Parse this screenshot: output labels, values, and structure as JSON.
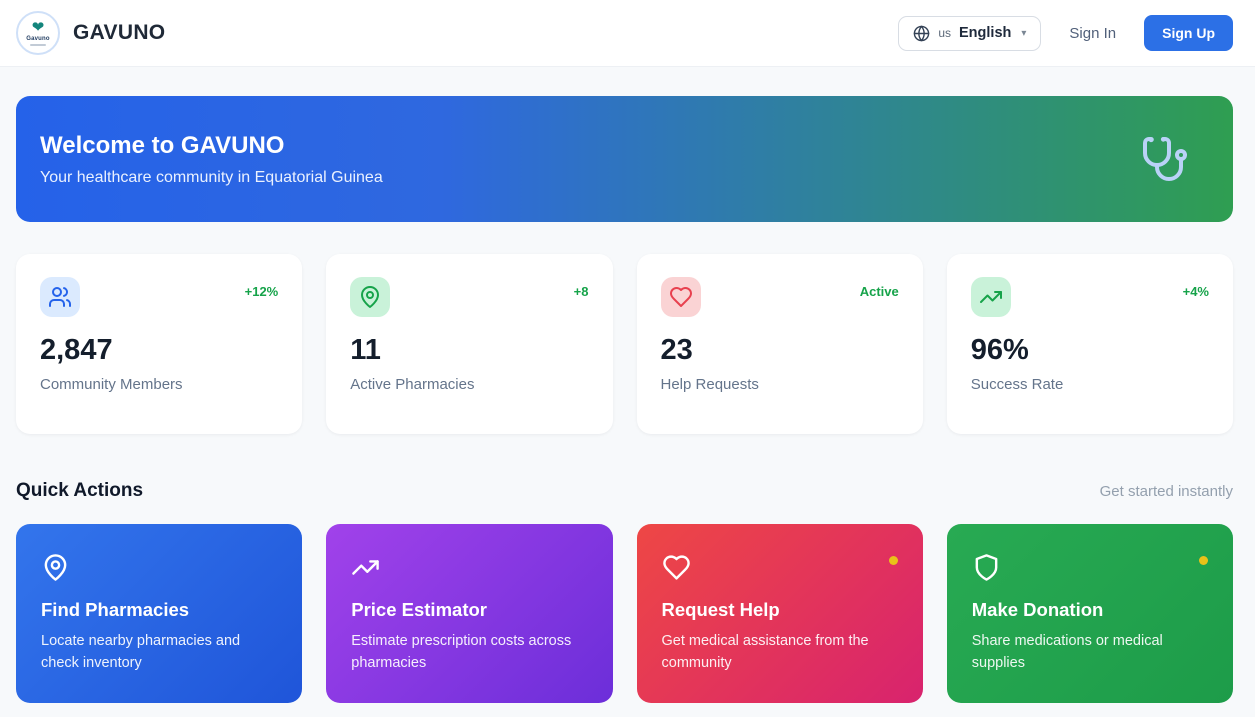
{
  "header": {
    "brand": "GAVUNO",
    "logo_text": "Gavuno",
    "language": {
      "code": "us",
      "label": "English"
    },
    "sign_in": "Sign In",
    "sign_up": "Sign Up"
  },
  "hero": {
    "title": "Welcome to GAVUNO",
    "subtitle": "Your healthcare community in Equatorial Guinea"
  },
  "stats": [
    {
      "icon": "users-icon",
      "value": "2,847",
      "label": "Community Members",
      "trend": "+12%",
      "accent": "#2563eb"
    },
    {
      "icon": "map-pin-icon",
      "value": "11",
      "label": "Active Pharmacies",
      "trend": "+8",
      "accent": "#17a34a"
    },
    {
      "icon": "heart-icon",
      "value": "23",
      "label": "Help Requests",
      "trend": "Active",
      "accent": "#e8414f"
    },
    {
      "icon": "trending-up-icon",
      "value": "96%",
      "label": "Success Rate",
      "trend": "+4%",
      "accent": "#17a34a"
    }
  ],
  "quick_actions": {
    "title": "Quick Actions",
    "hint": "Get started instantly",
    "cards": [
      {
        "icon": "map-pin-icon",
        "title": "Find Pharmacies",
        "description": "Locate nearby pharmacies and check inventory",
        "notification_dot": false,
        "color": "#2a63e2"
      },
      {
        "icon": "trending-up-icon",
        "title": "Price Estimator",
        "description": "Estimate prescription costs across pharmacies",
        "notification_dot": false,
        "color": "#8a3ae3"
      },
      {
        "icon": "heart-icon",
        "title": "Request Help",
        "description": "Get medical assistance from the community",
        "notification_dot": true,
        "color": "#e23459"
      },
      {
        "icon": "shield-icon",
        "title": "Make Donation",
        "description": "Share medications or medical supplies",
        "notification_dot": true,
        "color": "#23a44e"
      }
    ]
  },
  "colors": {
    "trend_green": "#16a34a",
    "signup_blue": "#2c70e6",
    "hero_gradient_start": "#2562e9",
    "hero_gradient_end": "#2f9e51",
    "notification_yellow": "#e9c119",
    "page_background": "#f7f9fb"
  }
}
